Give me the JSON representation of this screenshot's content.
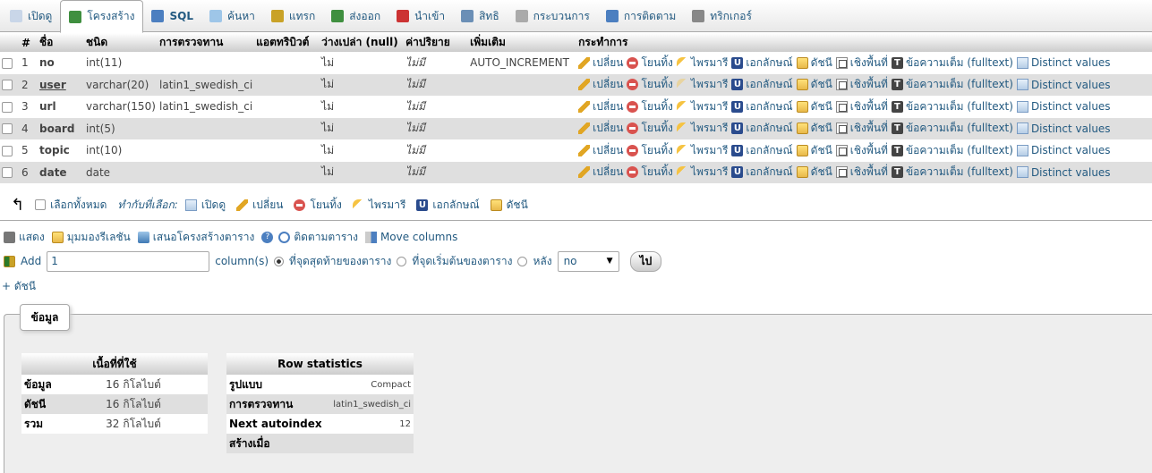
{
  "tabs": [
    {
      "label": "เปิดดู",
      "icon": "browse-icon",
      "active": false
    },
    {
      "label": "โครงสร้าง",
      "icon": "structure-icon",
      "active": true
    },
    {
      "label": "SQL",
      "icon": "sql-icon",
      "active": false
    },
    {
      "label": "ค้นหา",
      "icon": "search-icon",
      "active": false
    },
    {
      "label": "แทรก",
      "icon": "insert-icon",
      "active": false
    },
    {
      "label": "ส่งออก",
      "icon": "export-icon",
      "active": false
    },
    {
      "label": "นำเข้า",
      "icon": "import-icon",
      "active": false
    },
    {
      "label": "สิทธิ",
      "icon": "privileges-icon",
      "active": false
    },
    {
      "label": "กระบวนการ",
      "icon": "operations-icon",
      "active": false
    },
    {
      "label": "การติดตาม",
      "icon": "tracking-icon",
      "active": false
    },
    {
      "label": "ทริกเกอร์",
      "icon": "triggers-icon",
      "active": false
    }
  ],
  "columns_header": {
    "num": "#",
    "name": "ชื่อ",
    "type": "ชนิด",
    "collation": "การตรวจทาน",
    "attributes": "แอตทริบิวต์",
    "null": "ว่างเปล่า (null)",
    "default": "ค่าปริยาย",
    "extra": "เพิ่มเติม",
    "action": "กระทำการ"
  },
  "fields": [
    {
      "num": "1",
      "name": "no",
      "underline": false,
      "type": "int(11)",
      "collation": "",
      "attributes": "",
      "null": "ไม่",
      "default": "ไม่มี",
      "extra": "AUTO_INCREMENT",
      "primary_active": true
    },
    {
      "num": "2",
      "name": "user",
      "underline": true,
      "type": "varchar(20)",
      "collation": "latin1_swedish_ci",
      "attributes": "",
      "null": "ไม่",
      "default": "ไม่มี",
      "extra": "",
      "primary_active": false
    },
    {
      "num": "3",
      "name": "url",
      "underline": false,
      "type": "varchar(150)",
      "collation": "latin1_swedish_ci",
      "attributes": "",
      "null": "ไม่",
      "default": "ไม่มี",
      "extra": "",
      "primary_active": true
    },
    {
      "num": "4",
      "name": "board",
      "underline": false,
      "type": "int(5)",
      "collation": "",
      "attributes": "",
      "null": "ไม่",
      "default": "ไม่มี",
      "extra": "",
      "primary_active": true
    },
    {
      "num": "5",
      "name": "topic",
      "underline": false,
      "type": "int(10)",
      "collation": "",
      "attributes": "",
      "null": "ไม่",
      "default": "ไม่มี",
      "extra": "",
      "primary_active": true
    },
    {
      "num": "6",
      "name": "date",
      "underline": false,
      "type": "date",
      "collation": "",
      "attributes": "",
      "null": "ไม่",
      "default": "ไม่มี",
      "extra": "",
      "primary_active": true
    }
  ],
  "row_actions": {
    "change": "เปลี่ยน",
    "drop": "โยนทิ้ง",
    "primary": "ไพรมารี",
    "unique": "เอกลักษณ์",
    "index": "ดัชนี",
    "spatial": "เชิงพื้นที่",
    "fulltext": "ข้อความเต็ม (fulltext)",
    "distinct": "Distinct values"
  },
  "bulk": {
    "check_all": "เลือกทั้งหมด",
    "with_selected": "ทำกับที่เลือก:",
    "browse": "เปิดดู",
    "change": "เปลี่ยน",
    "drop": "โยนทิ้ง",
    "primary": "ไพรมารี",
    "unique": "เอกลักษณ์",
    "index": "ดัชนี"
  },
  "links": {
    "print": "แสดง",
    "relation": "มุมมองรีเลชัน",
    "propose": "เสนอโครงสร้างตาราง",
    "track": "ติดตามตาราง",
    "move": "Move columns"
  },
  "add_row": {
    "add_label": "Add",
    "count_value": "1",
    "columns_text": "column(s)",
    "at_end": "ที่จุดสุดท้ายของตาราง",
    "at_begin": "ที่จุดเริ่มต้นของตาราง",
    "after": "หลัง",
    "after_field": "no",
    "go": "ไป"
  },
  "index_link": "+ ดัชนี",
  "info": {
    "legend": "ข้อมูล",
    "space": {
      "title": "เนื้อที่ที่ใช้",
      "rows": [
        {
          "label": "ข้อมูล",
          "value": "16",
          "unit": "กิโลไบต์"
        },
        {
          "label": "ดัชนี",
          "value": "16",
          "unit": "กิโลไบต์"
        },
        {
          "label": "รวม",
          "value": "32",
          "unit": "กิโลไบต์"
        }
      ]
    },
    "row_stats": {
      "title": "Row statistics",
      "rows": [
        {
          "label": "รูปแบบ",
          "value": "Compact"
        },
        {
          "label": "การตรวจทาน",
          "value": "latin1_swedish_ci"
        },
        {
          "label": "Next autoindex",
          "value": "12"
        },
        {
          "label": "สร้างเมื่อ",
          "value": ""
        }
      ]
    }
  },
  "colors": {
    "link": "#235a81",
    "row_alt": "#dfdfdf",
    "panel_bg": "#eeeeee"
  }
}
